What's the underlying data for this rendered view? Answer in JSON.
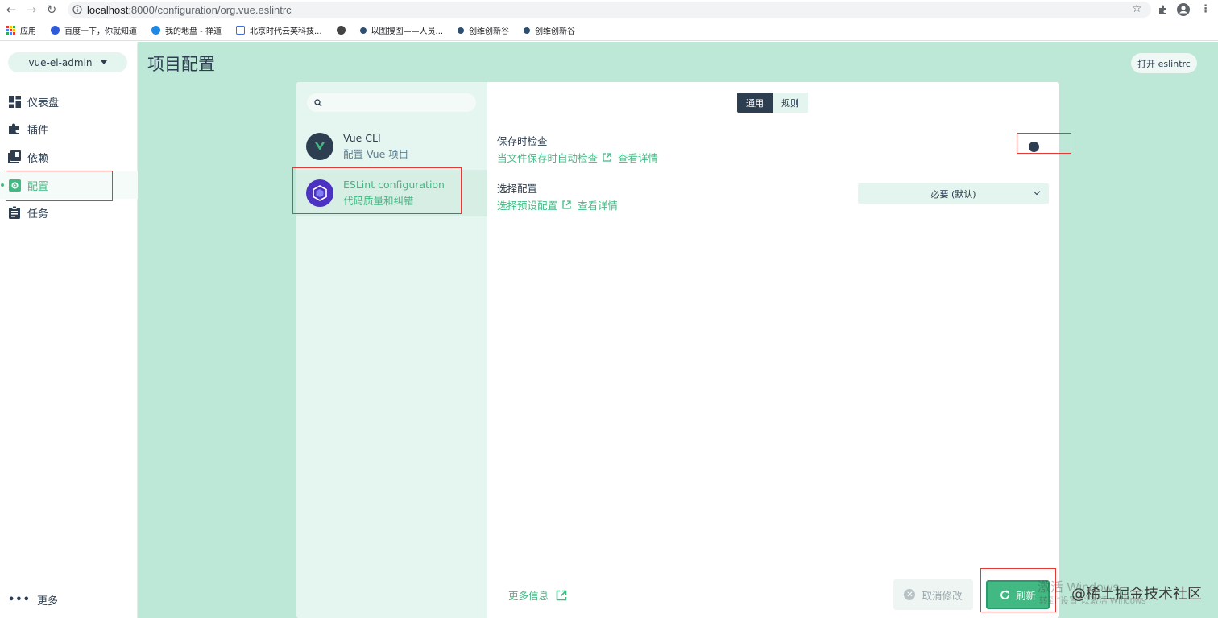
{
  "browser": {
    "url_host": "localhost",
    "url_rest": ":8000/configuration/org.vue.eslintrc",
    "bookmarks": [
      {
        "label": "应用",
        "color": "#e53935"
      },
      {
        "label": "百度一下，你就知道",
        "color": "#2f5bd9"
      },
      {
        "label": "我的地盘 - 禅道",
        "color": "#1e88e5"
      },
      {
        "label": "北京时代云英科技...",
        "color": "#3a6fd8"
      },
      {
        "label": "",
        "color": "#444444"
      },
      {
        "label": "以图搜图——人员...",
        "color": "#2d4f73"
      },
      {
        "label": "创维创新谷",
        "color": "#2d4f73"
      },
      {
        "label": "创维创新谷",
        "color": "#2d4f73"
      }
    ]
  },
  "sidebar": {
    "project": "vue-el-admin",
    "items": [
      {
        "label": "仪表盘",
        "icon": "dashboard-icon"
      },
      {
        "label": "插件",
        "icon": "puzzle-icon"
      },
      {
        "label": "依赖",
        "icon": "library-icon"
      },
      {
        "label": "配置",
        "icon": "settings-icon"
      },
      {
        "label": "任务",
        "icon": "assignment-icon"
      }
    ],
    "more": "更多"
  },
  "main": {
    "title": "项目配置",
    "open_button": "打开 eslintrc"
  },
  "plugins": [
    {
      "name": "Vue CLI",
      "desc": "配置 Vue 项目"
    },
    {
      "name": "ESLint configuration",
      "desc": "代码质量和纠错"
    }
  ],
  "tabs": [
    "通用",
    "规则"
  ],
  "fields": {
    "lint_on_save": {
      "label": "保存时检查",
      "desc": "当文件保存时自动检查",
      "details": "查看详情"
    },
    "config": {
      "label": "选择配置",
      "desc": "选择预设配置",
      "details": "查看详情",
      "value": "必要 (默认)"
    }
  },
  "footer": {
    "more_info": "更多信息",
    "cancel": "取消修改",
    "refresh": "刷新"
  },
  "watermark": {
    "line1": "激活 Windows",
    "line2": "转到\"设置\"以激活 Windows",
    "site": "@稀土掘金技术社区"
  },
  "colors": {
    "accent": "#42b983",
    "dark": "#2c3e50",
    "bg": "#bde7d6"
  }
}
